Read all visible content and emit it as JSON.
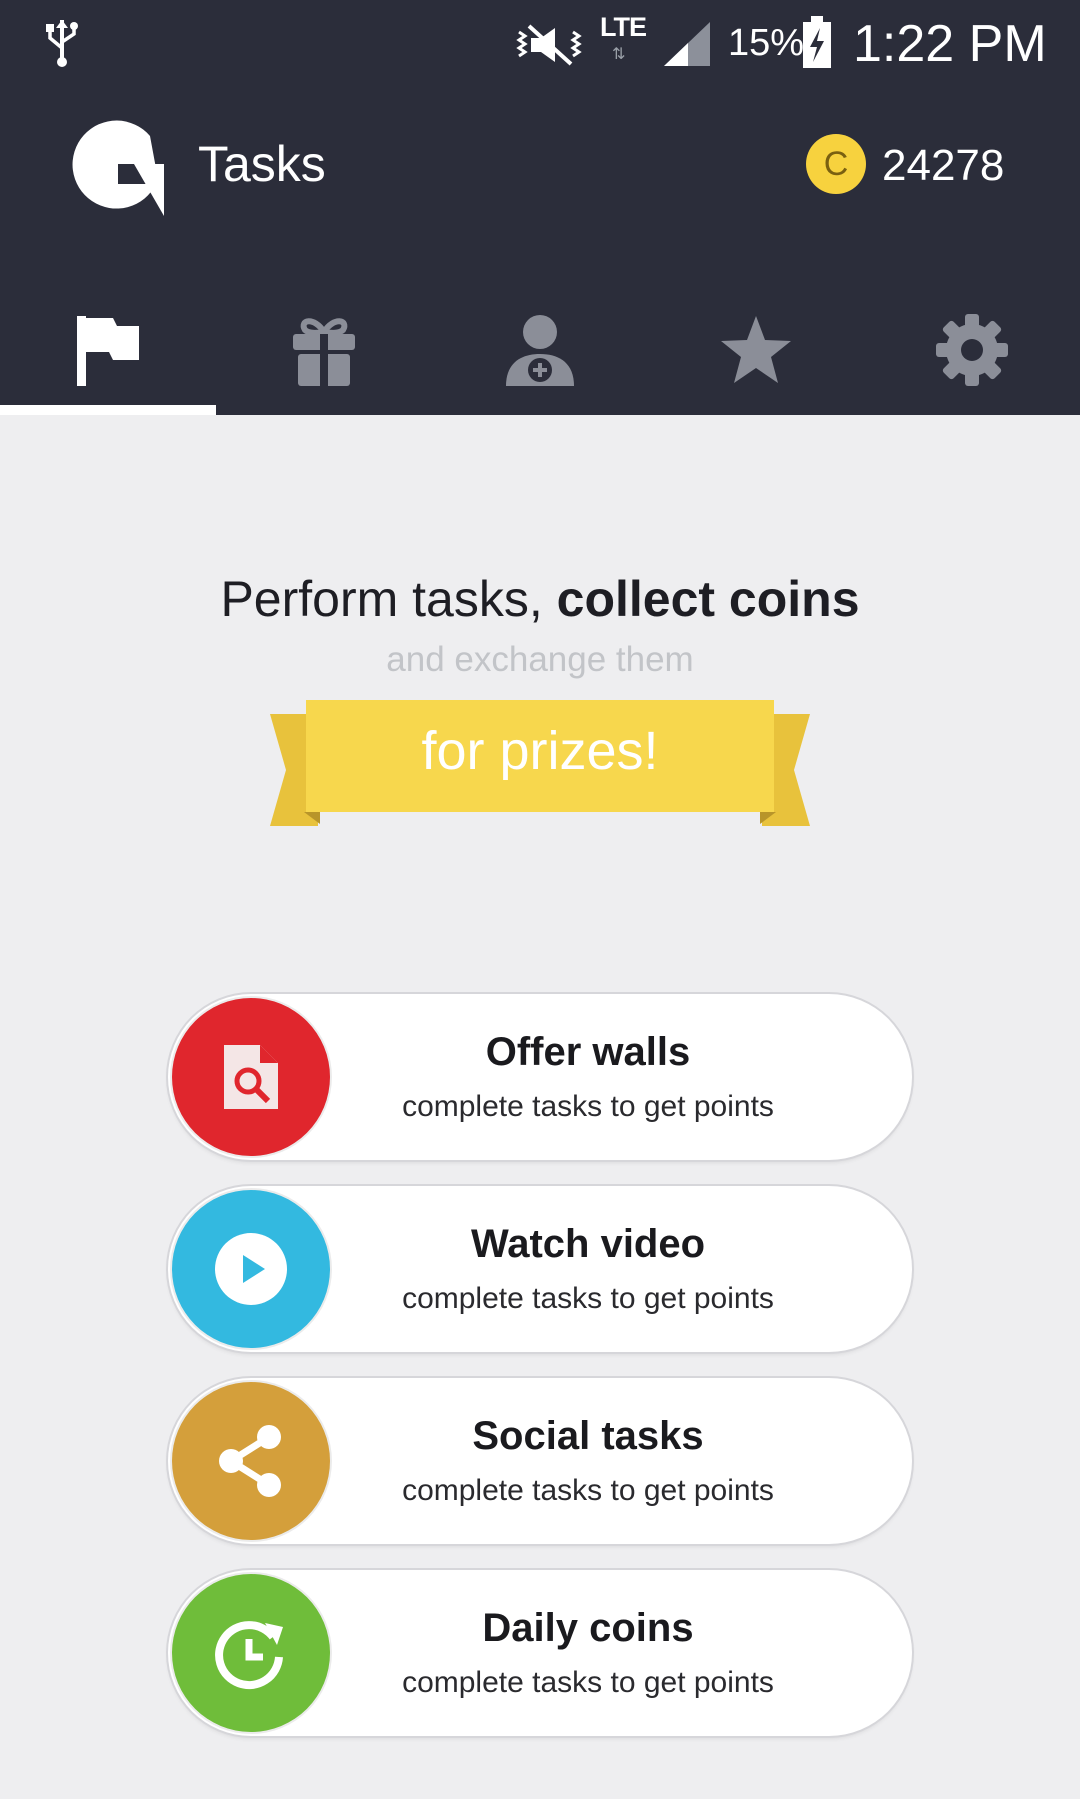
{
  "status_bar": {
    "network": "LTE",
    "battery": "15%",
    "time": "1:22 PM"
  },
  "app_bar": {
    "title": "Tasks",
    "coin_symbol": "C",
    "coin_balance": "24278"
  },
  "tabs": [
    {
      "icon": "flag-icon",
      "selected": true
    },
    {
      "icon": "gift-icon",
      "selected": false
    },
    {
      "icon": "add-person-icon",
      "selected": false
    },
    {
      "icon": "star-icon",
      "selected": false
    },
    {
      "icon": "gear-icon",
      "selected": false
    }
  ],
  "hero": {
    "headline_normal": "Perform tasks, ",
    "headline_bold": "collect coins",
    "subline": "and exchange them",
    "ribbon": "for prizes!"
  },
  "tasks": [
    {
      "title": "Offer walls",
      "subtitle": "complete tasks to get points",
      "icon": "document-search-icon",
      "color": "#e0262d"
    },
    {
      "title": "Watch video",
      "subtitle": "complete tasks to get points",
      "icon": "play-icon",
      "color": "#33b9e0"
    },
    {
      "title": "Social tasks",
      "subtitle": "complete tasks to get points",
      "icon": "share-icon",
      "color": "#d49f3b"
    },
    {
      "title": "Daily coins",
      "subtitle": "complete tasks to get points",
      "icon": "clock-refresh-icon",
      "color": "#6fbd3a"
    }
  ],
  "colors": {
    "app_bar": "#2b2d3a",
    "background": "#eeeef0",
    "coin": "#f7d23e",
    "ribbon": "#f7d74d"
  }
}
